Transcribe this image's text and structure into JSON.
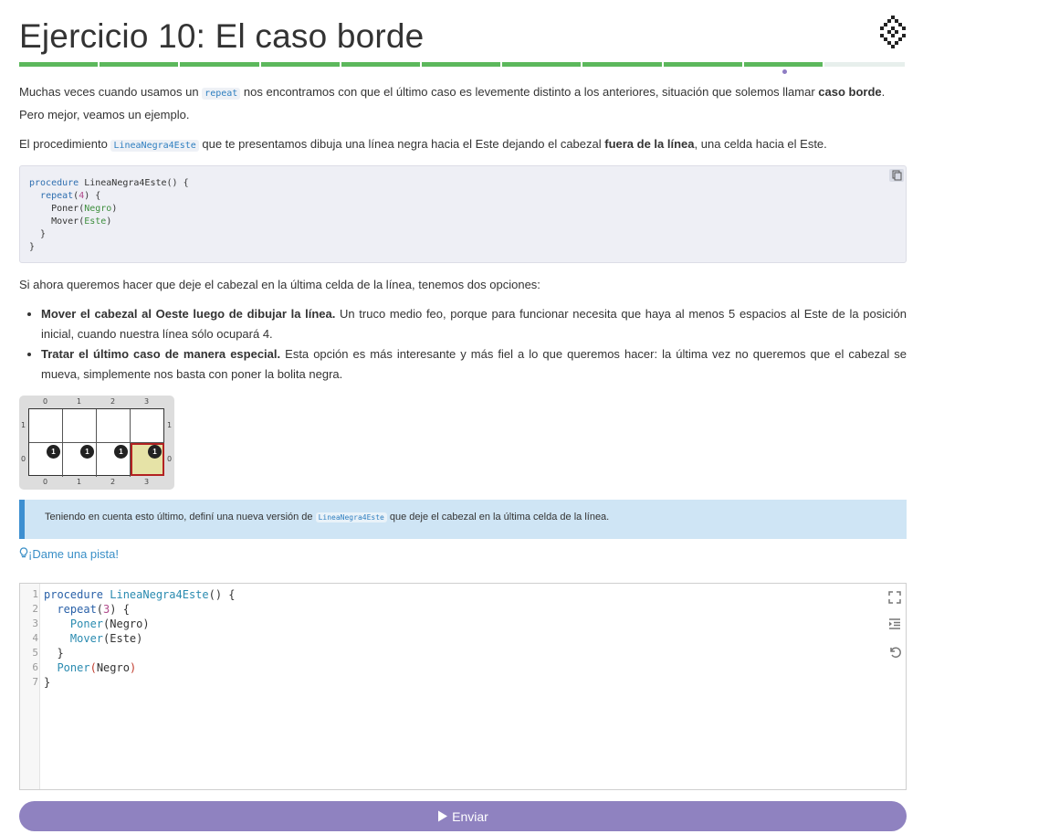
{
  "header": {
    "title": "Ejercicio 10: El caso borde",
    "progress": {
      "completed_segments": 10,
      "total_segments": 11
    }
  },
  "intro": {
    "p1_a": "Muchas veces cuando usamos un ",
    "p1_code": "repeat",
    "p1_b": " nos encontramos con que el último caso es levemente distinto a los anteriores, situación que solemos llamar ",
    "p1_bold": "caso borde",
    "p1_c": ". Pero mejor, veamos un ejemplo.",
    "p2_a": "El procedimiento ",
    "p2_code": "LineaNegra4Este",
    "p2_b": " que te presentamos dibuja una línea negra hacia el Este dejando el cabezal ",
    "p2_bold": "fuera de la línea",
    "p2_c": ", una celda hacia el Este."
  },
  "example_code": {
    "l1_kw": "procedure",
    "l1_rest": " LineaNegra4Este() {",
    "l2_kw": "repeat",
    "l2_a": "(",
    "l2_num": "4",
    "l2_b": ") {",
    "l3_a": "Poner(",
    "l3_g": "Negro",
    "l3_b": ")",
    "l4_a": "Mover(",
    "l4_g": "Este",
    "l4_b": ")",
    "l5": "}",
    "l6": "}"
  },
  "options": {
    "intro": "Si ahora queremos hacer que deje el cabezal en la última celda de la línea, tenemos dos opciones:",
    "o1_bold": "Mover el cabezal al Oeste luego de dibujar la línea.",
    "o1_rest": " Un truco medio feo, porque para funcionar necesita que haya al menos 5 espacios al Este de la posición inicial, cuando nuestra línea sólo ocupará 4.",
    "o2_bold": "Tratar el último caso de manera especial.",
    "o2_rest": " Esta opción es más interesante y más fiel a lo que queremos hacer: la última vez no queremos que el cabezal se mueva, simplemente nos basta con poner la bolita negra."
  },
  "board": {
    "col_labels": [
      "0",
      "1",
      "2",
      "3"
    ],
    "row_labels": [
      "1",
      "0"
    ],
    "ball_count": "1",
    "head_cell": "3,0"
  },
  "notice": {
    "a": "Teniendo en cuenta esto último, definí una nueva versión de ",
    "code": "LineaNegra4Este",
    "b": " que deje el cabezal en la última celda de la línea."
  },
  "hint": {
    "icon": "lightbulb-icon",
    "label": "¡Dame una pista!"
  },
  "editor": {
    "line_numbers": [
      "1",
      "2",
      "3",
      "4",
      "5",
      "6",
      "7"
    ],
    "l1_kw": "procedure",
    "l1_name": " LineaNegra4Este",
    "l1_rest": "() {",
    "l2_kw": "  repeat",
    "l2_a": "(",
    "l2_num": "3",
    "l2_b": ") {",
    "l3_fn": "    Poner",
    "l3_rest": "(Negro)",
    "l4_fn": "    Mover",
    "l4_rest": "(Este)",
    "l5": "  }",
    "l6_fn": "  Poner",
    "l6_a": "(",
    "l6_mid": "Negro",
    "l6_b": ")",
    "l7": "}"
  },
  "submit": {
    "label": "Enviar",
    "icon": "play-icon"
  },
  "colors": {
    "accent": "#8f82c0",
    "progress": "#5cb85c",
    "notice": "#cfe5f5"
  }
}
